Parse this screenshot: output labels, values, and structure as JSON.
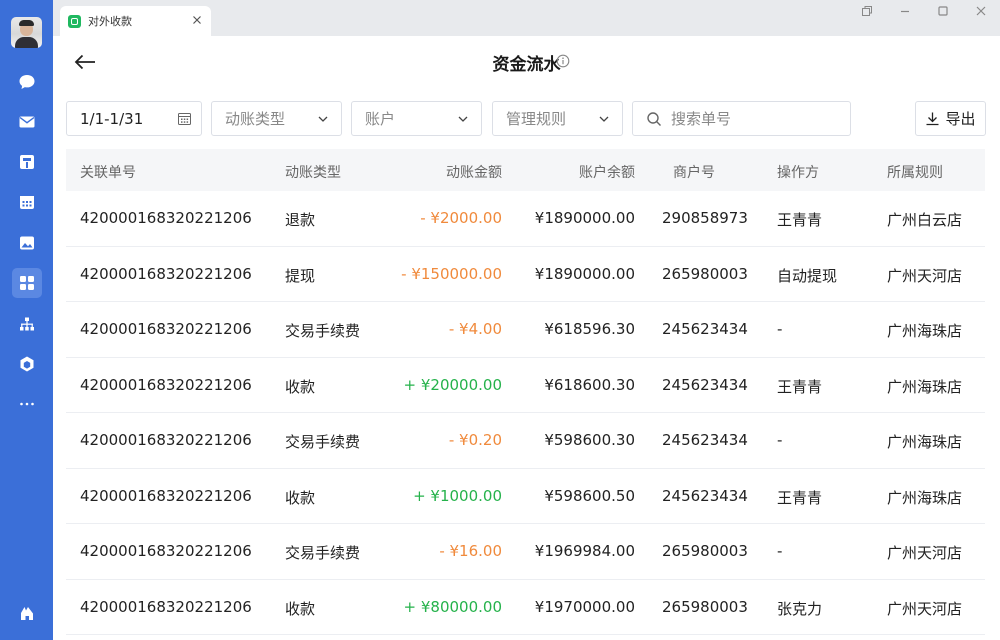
{
  "app": {
    "tab_title": "对外收款"
  },
  "header": {
    "title": "资金流水"
  },
  "filters": {
    "date_range": "1/1-1/31",
    "type_placeholder": "动账类型",
    "account_placeholder": "账户",
    "rule_placeholder": "管理规则",
    "search_placeholder": "搜索单号",
    "export_label": "导出"
  },
  "nav": {
    "items": [
      "chat-icon",
      "mail-icon",
      "docs-icon",
      "calendar-icon",
      "image-icon",
      "apps-icon",
      "org-icon",
      "cube-icon",
      "more-icon",
      "home-icon"
    ],
    "active": "apps-icon"
  },
  "colors": {
    "sidebar": "#3b6fd8",
    "negative": "#f08a3c",
    "positive": "#25b24b"
  },
  "table": {
    "columns": [
      "关联单号",
      "动账类型",
      "动账金额",
      "账户余额",
      "商户号",
      "操作方",
      "所属规则"
    ],
    "rows": [
      {
        "id": "420000168320221206",
        "type": "退款",
        "amount": "- ¥2000.00",
        "sign": "neg",
        "balance": "¥1890000.00",
        "merchant": "290858973",
        "operator": "王青青",
        "rule": "广州白云店"
      },
      {
        "id": "420000168320221206",
        "type": "提现",
        "amount": "- ¥150000.00",
        "sign": "neg",
        "balance": "¥1890000.00",
        "merchant": "265980003",
        "operator": "自动提现",
        "rule": "广州天河店"
      },
      {
        "id": "420000168320221206",
        "type": "交易手续费",
        "amount": "- ¥4.00",
        "sign": "neg",
        "balance": "¥618596.30",
        "merchant": "245623434",
        "operator": "-",
        "rule": "广州海珠店"
      },
      {
        "id": "420000168320221206",
        "type": "收款",
        "amount": "+ ¥20000.00",
        "sign": "pos",
        "balance": "¥618600.30",
        "merchant": "245623434",
        "operator": "王青青",
        "rule": "广州海珠店"
      },
      {
        "id": "420000168320221206",
        "type": "交易手续费",
        "amount": "- ¥0.20",
        "sign": "neg",
        "balance": "¥598600.30",
        "merchant": "245623434",
        "operator": "-",
        "rule": "广州海珠店"
      },
      {
        "id": "420000168320221206",
        "type": "收款",
        "amount": "+ ¥1000.00",
        "sign": "pos",
        "balance": "¥598600.50",
        "merchant": "245623434",
        "operator": "王青青",
        "rule": "广州海珠店"
      },
      {
        "id": "420000168320221206",
        "type": "交易手续费",
        "amount": "- ¥16.00",
        "sign": "neg",
        "balance": "¥1969984.00",
        "merchant": "265980003",
        "operator": "-",
        "rule": "广州天河店"
      },
      {
        "id": "420000168320221206",
        "type": "收款",
        "amount": "+ ¥80000.00",
        "sign": "pos",
        "balance": "¥1970000.00",
        "merchant": "265980003",
        "operator": "张克力",
        "rule": "广州天河店"
      }
    ]
  }
}
